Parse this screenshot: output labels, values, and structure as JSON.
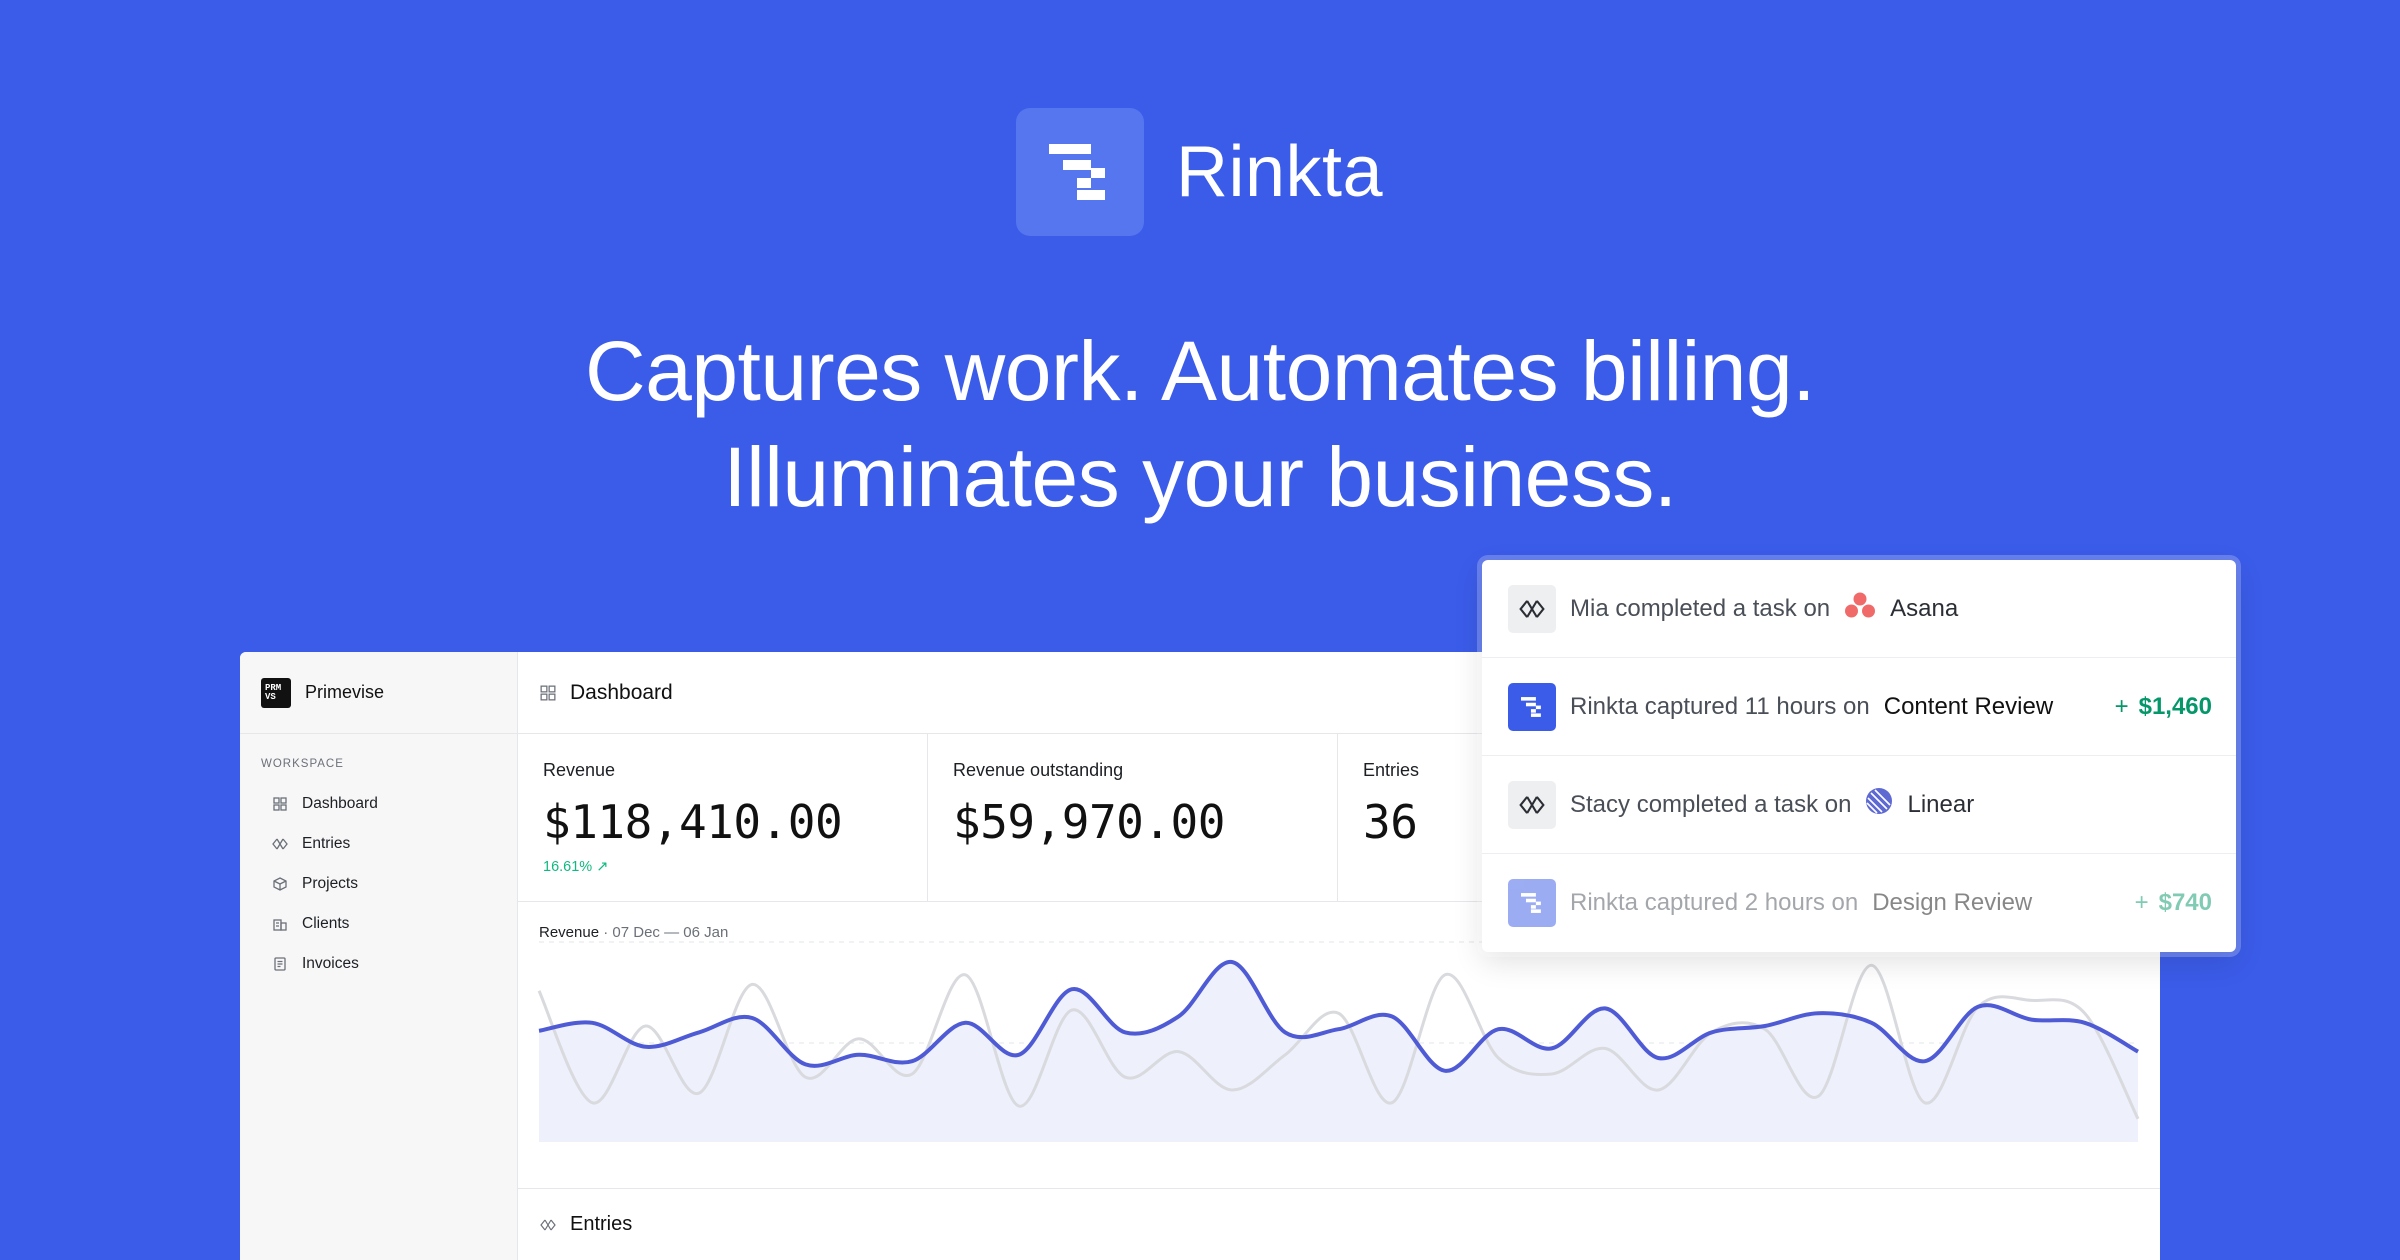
{
  "brand": {
    "name": "Rinkta",
    "logo_icon": "rinkta-mark-icon"
  },
  "headline": {
    "line1": "Captures work. Automates billing.",
    "line2": "Illuminates your business."
  },
  "colors": {
    "background": "#3b5ce9",
    "accent": "#4f5bd5",
    "positive": "#10b981",
    "asana": "#f06a6a"
  },
  "sidebar": {
    "org_logo_text": "PRM VS",
    "org_name": "Primevise",
    "section_label": "WORKSPACE",
    "items": [
      {
        "label": "Dashboard",
        "icon": "grid-icon"
      },
      {
        "label": "Entries",
        "icon": "diamond-arrows-icon"
      },
      {
        "label": "Projects",
        "icon": "cube-icon"
      },
      {
        "label": "Clients",
        "icon": "building-icon"
      },
      {
        "label": "Invoices",
        "icon": "invoice-icon"
      }
    ]
  },
  "topbar": {
    "title": "Dashboard",
    "icon": "grid-icon"
  },
  "stats": [
    {
      "label": "Revenue",
      "value": "$118,410.00",
      "delta": "16.61% ↗"
    },
    {
      "label": "Revenue outstanding",
      "value": "$59,970.00",
      "delta": ""
    },
    {
      "label": "Entries",
      "value": "36",
      "delta": ""
    }
  ],
  "chart": {
    "title": "Revenue",
    "separator": "·",
    "range": "07 Dec — 06 Jan"
  },
  "chart_data": {
    "type": "area",
    "title": "Revenue",
    "xlabel": "",
    "ylabel": "",
    "grid": true,
    "series": [
      {
        "values": [
          0.57,
          0.62,
          0.47,
          0.56,
          0.65,
          0.36,
          0.42,
          0.38,
          0.62,
          0.42,
          0.83,
          0.56,
          0.66,
          1.0,
          0.56,
          0.58,
          0.66,
          0.32,
          0.58,
          0.46,
          0.71,
          0.4,
          0.56,
          0.6,
          0.68,
          0.62,
          0.38,
          0.72,
          0.64,
          0.62,
          0.44
        ],
        "color": "#4f5bd5",
        "fill": "#eef0fc"
      },
      {
        "values": [
          0.82,
          0.12,
          0.6,
          0.18,
          0.86,
          0.28,
          0.52,
          0.3,
          0.92,
          0.1,
          0.7,
          0.28,
          0.44,
          0.2,
          0.42,
          0.68,
          0.12,
          0.92,
          0.4,
          0.3,
          0.46,
          0.2,
          0.56,
          0.58,
          0.16,
          0.98,
          0.12,
          0.72,
          0.76,
          0.68,
          0.02
        ],
        "color": "#d9dade"
      }
    ]
  },
  "entries_section": {
    "title": "Entries",
    "icon": "diamond-arrows-icon"
  },
  "feed": [
    {
      "text": "Mia completed a task on",
      "app": "Asana",
      "app_icon": "asana-icon",
      "icon": "diamond-arrows-icon",
      "amount": ""
    },
    {
      "text": "Rinkta captured 11 hours on",
      "target": "Content Review",
      "icon": "rinkta-mark-icon",
      "amount_sign": "+",
      "amount": "$1,460"
    },
    {
      "text": "Stacy completed a task on",
      "app": "Linear",
      "app_icon": "linear-icon",
      "icon": "diamond-arrows-icon",
      "amount": ""
    },
    {
      "text": "Rinkta captured 2 hours on",
      "target": "Design Review",
      "icon": "rinkta-mark-icon",
      "amount_sign": "+",
      "amount": "$740"
    }
  ]
}
